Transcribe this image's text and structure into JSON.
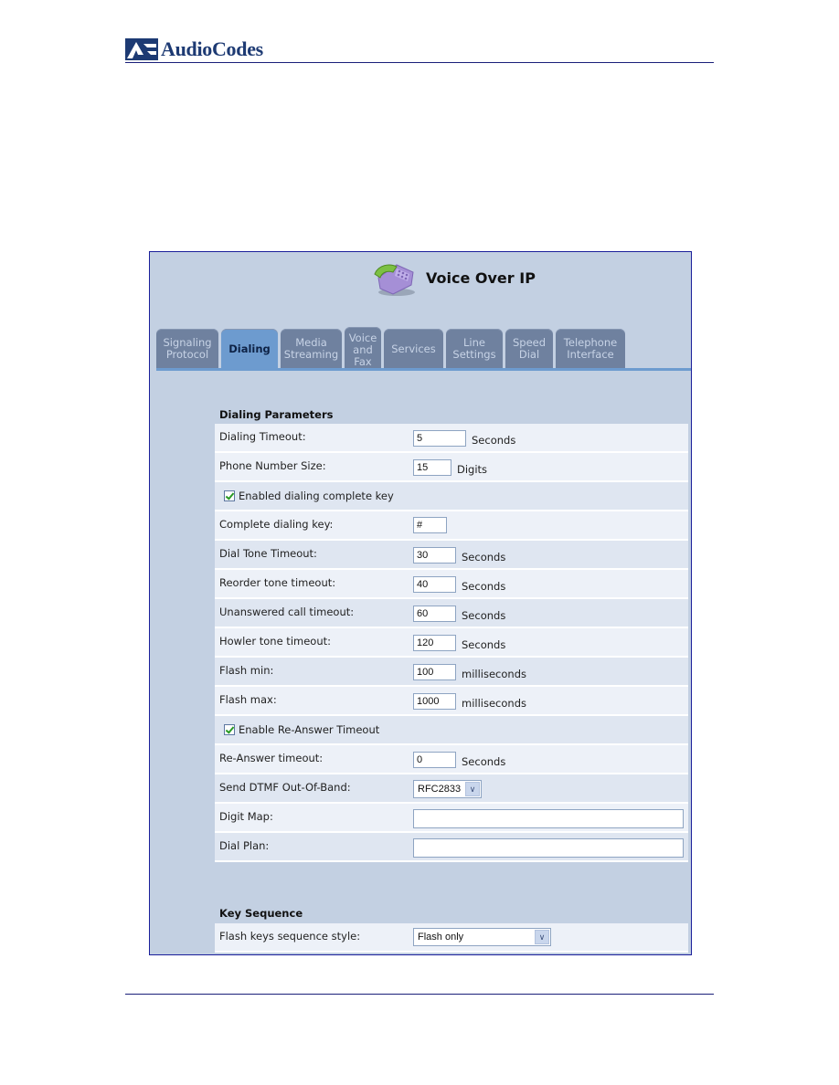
{
  "document": {
    "brand_name": "AudioCodes",
    "logo_icon": "audiocodes-logo-icon"
  },
  "app": {
    "title": "Voice Over IP",
    "title_icon": "telephone-icon"
  },
  "tabs": [
    {
      "label": "Signaling\nProtocol",
      "active": false
    },
    {
      "label": "Dialing",
      "active": true
    },
    {
      "label": "Media\nStreaming",
      "active": false
    },
    {
      "label": "Voice\nand\nFax",
      "active": false
    },
    {
      "label": "Services",
      "active": false
    },
    {
      "label": "Line\nSettings",
      "active": false
    },
    {
      "label": "Speed\nDial",
      "active": false
    },
    {
      "label": "Telephone\nInterface",
      "active": false
    }
  ],
  "dialing_parameters": {
    "section_title": "Dialing Parameters",
    "dialing_timeout": {
      "label": "Dialing Timeout:",
      "value": "5",
      "unit": "Seconds"
    },
    "phone_number_size": {
      "label": "Phone Number Size:",
      "value": "15",
      "unit": "Digits"
    },
    "enabled_complete_key": {
      "label": "Enabled dialing complete key",
      "checked": true
    },
    "complete_dialing_key": {
      "label": "Complete dialing key:",
      "value": "#"
    },
    "dial_tone_timeout": {
      "label": "Dial Tone Timeout:",
      "value": "30",
      "unit": "Seconds"
    },
    "reorder_tone_timeout": {
      "label": "Reorder tone timeout:",
      "value": "40",
      "unit": "Seconds"
    },
    "unanswered_call_timeout": {
      "label": "Unanswered call timeout:",
      "value": "60",
      "unit": "Seconds"
    },
    "howler_tone_timeout": {
      "label": "Howler tone timeout:",
      "value": "120",
      "unit": "Seconds"
    },
    "flash_min": {
      "label": "Flash min:",
      "value": "100",
      "unit": "milliseconds"
    },
    "flash_max": {
      "label": "Flash max:",
      "value": "1000",
      "unit": "milliseconds"
    },
    "enable_reanswer": {
      "label": "Enable Re-Answer Timeout",
      "checked": true
    },
    "reanswer_timeout": {
      "label": "Re-Answer timeout:",
      "value": "0",
      "unit": "Seconds"
    },
    "send_dtmf": {
      "label": "Send DTMF Out-Of-Band:",
      "value": "RFC2833"
    },
    "digit_map": {
      "label": "Digit Map:",
      "value": ""
    },
    "dial_plan": {
      "label": "Dial Plan:",
      "value": ""
    }
  },
  "key_sequence": {
    "section_title": "Key Sequence",
    "flash_keys_style": {
      "label": "Flash keys sequence style:",
      "value": "Flash only"
    }
  },
  "colors": {
    "panel_bg": "#c3d0e2",
    "tab_active": "#6d9bcf",
    "tab_inactive": "#6f819f",
    "rule": "#1a1f7a"
  }
}
